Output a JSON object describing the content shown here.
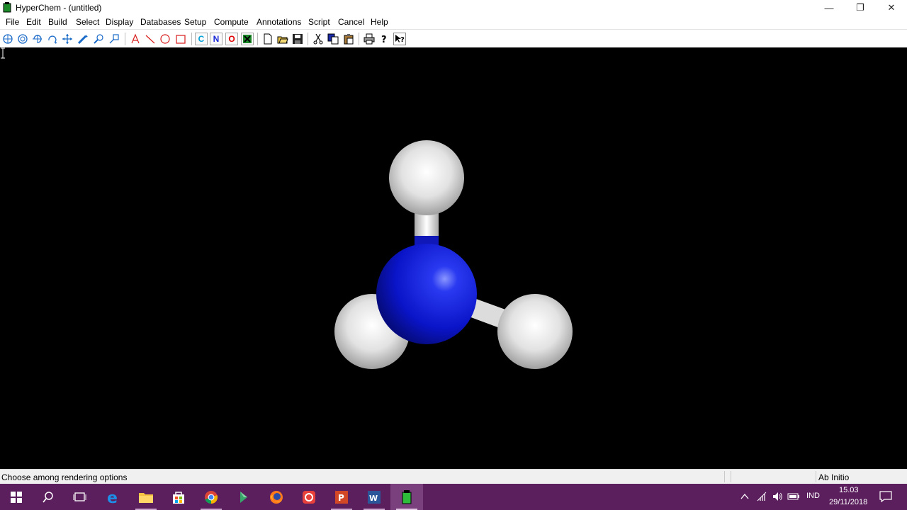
{
  "window": {
    "title": "HyperChem - (untitled)",
    "controls": {
      "minimize": "—",
      "maximize": "❐",
      "close": "✕"
    }
  },
  "menu": [
    "File",
    "Edit",
    "Build",
    "Select",
    "Display",
    "Databases",
    "Setup",
    "Compute",
    "Annotations",
    "Script",
    "Cancel",
    "Help"
  ],
  "toolbar": {
    "tools": [
      "select-icon",
      "rotate-out-of-plane-icon",
      "rotate-in-plane-icon",
      "rotate-z-icon",
      "translate-icon",
      "draw-icon",
      "zoom-icon",
      "z-clip-icon",
      "text-annotation-icon",
      "line-annotation-icon",
      "ellipse-annotation-icon",
      "rectangle-annotation-icon"
    ],
    "elements": {
      "carbon": "C",
      "nitrogen": "N",
      "oxygen": "O"
    },
    "element_colors": {
      "carbon": "#00a0d8",
      "nitrogen": "#1a2ad8",
      "oxygen": "#e00000"
    },
    "annotation_color": "#d81c1c",
    "tool_color": "#1a6ac8",
    "file_tools": [
      "new-file-icon",
      "open-file-icon",
      "save-icon",
      "cut-icon",
      "copy-icon",
      "paste-icon",
      "print-icon",
      "help-icon",
      "context-help-icon"
    ]
  },
  "molecule": {
    "description_atoms": [
      "H",
      "H",
      "H",
      "N"
    ],
    "colors": {
      "nitrogen": "#1020d0",
      "hydrogen": "#e8e8e8",
      "background": "#000000"
    }
  },
  "statusbar": {
    "message": "Choose among rendering options",
    "method": "Ab Initio"
  },
  "taskbar": {
    "apps": [
      "start-icon",
      "search-icon",
      "task-view-icon",
      "edge-icon",
      "file-explorer-icon",
      "store-icon",
      "chrome-icon",
      "app-icon",
      "firefox-icon",
      "red-app-icon",
      "powerpoint-icon",
      "word-icon",
      "hyperchem-icon"
    ],
    "language": "IND",
    "time": "15.03",
    "date": "29/11/2018",
    "colors": {
      "background": "#5b1f5e",
      "active": "#7a3f7d"
    }
  }
}
